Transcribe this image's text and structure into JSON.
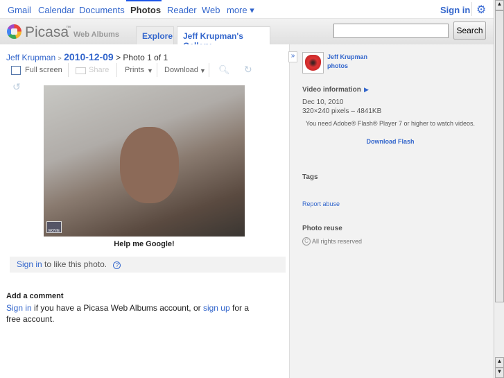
{
  "gbar": {
    "items": [
      "Gmail",
      "Calendar",
      "Documents",
      "Photos",
      "Reader",
      "Web",
      "more ▾"
    ],
    "selected": "Photos",
    "sign_in": "Sign in"
  },
  "header": {
    "logo": "Picasa",
    "logo_tm": "™",
    "logo_sub": "Web Albums",
    "tabs": [
      "Explore",
      "Jeff Krupman's Gallery"
    ],
    "search_value": "",
    "search_button": "Search"
  },
  "breadcrumb": {
    "user": "Jeff Krupman",
    "album": "2010-12-09",
    "position": "> Photo 1 of 1",
    "sep": ">"
  },
  "toolbar": {
    "fullscreen": "Full screen",
    "share": "Share",
    "prints": "Prints",
    "download": "Download"
  },
  "photo": {
    "caption": "Help me Google!",
    "badge": "MOVIE"
  },
  "like": {
    "sign_in": "Sign in",
    "text": " to like this photo.",
    "help": "?"
  },
  "comment": {
    "title": "Add a comment",
    "sign_in": "Sign in",
    "mid": " if you have a Picasa Web Albums account, or ",
    "sign_up": "sign up",
    "end": " for a free account."
  },
  "side": {
    "expand": "»",
    "owner": "Jeff Krupman",
    "owner_sub": "photos",
    "video_info": "Video information",
    "date": "Dec 10, 2010",
    "size": "320×240 pixels – 4841KB",
    "flash_msg": "You need Adobe® Flash® Player 7 or higher to watch videos.",
    "download_flash": "Download Flash",
    "tags": "Tags",
    "report": "Report abuse",
    "reuse": "Photo reuse",
    "rights": "All rights reserved"
  }
}
